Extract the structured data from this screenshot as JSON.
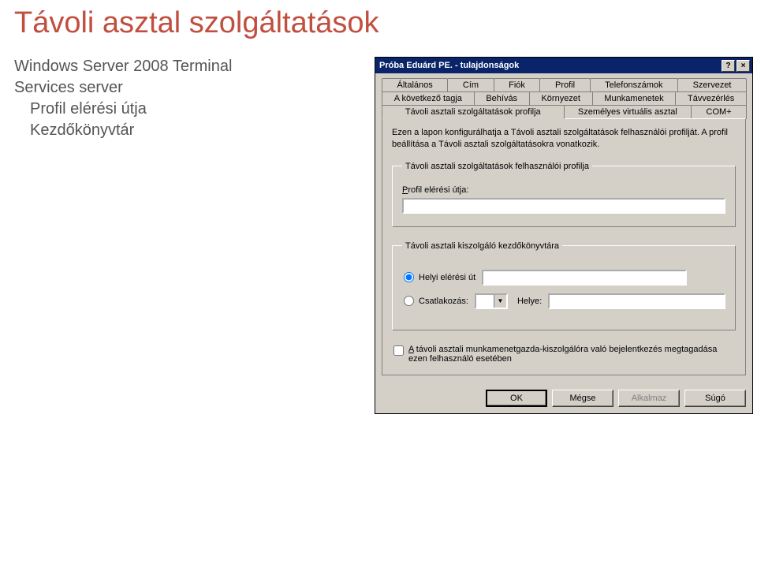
{
  "page": {
    "title": "Távoli asztal szolgáltatások",
    "side": {
      "line1": "Windows Server 2008 Terminal",
      "line2": "Services server",
      "line3": "Profil elérési útja",
      "line4": "Kezdőkönyvtár"
    }
  },
  "dialog": {
    "title": "Próba Eduárd PE. - tulajdonságok",
    "tabs_row1": [
      "Általános",
      "Cím",
      "Fiók",
      "Profil",
      "Telefonszámok",
      "Szervezet"
    ],
    "tabs_row2": [
      "A következő tagja",
      "Behívás",
      "Környezet",
      "Munkamenetek",
      "Távvezérlés"
    ],
    "tabs_row3": [
      "Távoli asztali szolgáltatások profilja",
      "Személyes virtuális asztal",
      "COM+"
    ],
    "active_tab": "Távoli asztali szolgáltatások profilja",
    "description": "Ezen a lapon konfigurálhatja a Távoli asztali szolgáltatások felhasználói profilját. A profil beállítása a Távoli asztali szolgáltatásokra vonatkozik.",
    "group1": {
      "legend": "Távoli asztali szolgáltatások felhasználói profilja",
      "label": "Profil elérési útja:",
      "value": ""
    },
    "group2": {
      "legend": "Távoli asztali kiszolgáló kezdőkönyvtára",
      "opt_local": "Helyi elérési út",
      "opt_connect": "Csatlakozás:",
      "place_label": "Helye:",
      "local_value": "",
      "drive_value": "",
      "place_value": ""
    },
    "deny": "A távoli asztali munkamenetgazda-kiszolgálóra való bejelentkezés megtagadása ezen felhasználó esetében",
    "buttons": {
      "ok": "OK",
      "cancel": "Mégse",
      "apply": "Alkalmaz",
      "help": "Súgó"
    }
  }
}
